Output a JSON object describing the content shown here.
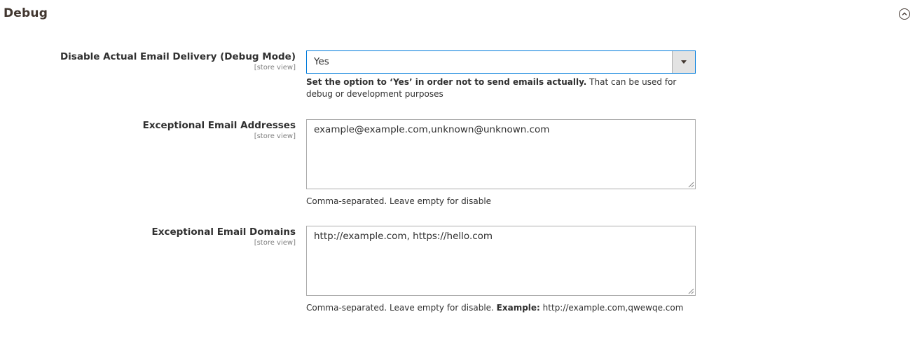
{
  "section": {
    "title": "Debug",
    "collapse_icon": "chevron-up-circle-icon"
  },
  "fields": {
    "disable_delivery": {
      "label": "Disable Actual Email Delivery (Debug Mode)",
      "scope": "[store view]",
      "value": "Yes",
      "note_bold": "Set the option to ‘Yes’ in order not to send emails actually.",
      "note_rest": " That can be used for debug or development purposes"
    },
    "exceptional_addresses": {
      "label": "Exceptional Email Addresses",
      "scope": "[store view]",
      "value": "example@example.com,unknown@unknown.com",
      "note": "Comma-separated. Leave empty for disable"
    },
    "exceptional_domains": {
      "label": "Exceptional Email Domains",
      "scope": "[store view]",
      "value": "http://example.com, https://hello.com",
      "note_prefix": "Comma-separated. Leave empty for disable. ",
      "note_bold": "Example:",
      "note_suffix": " http://example.com,qwewqe.com"
    }
  },
  "colors": {
    "focus_border": "#007bdb",
    "input_border": "#adadad",
    "select_button_bg": "#e3e3e3"
  }
}
